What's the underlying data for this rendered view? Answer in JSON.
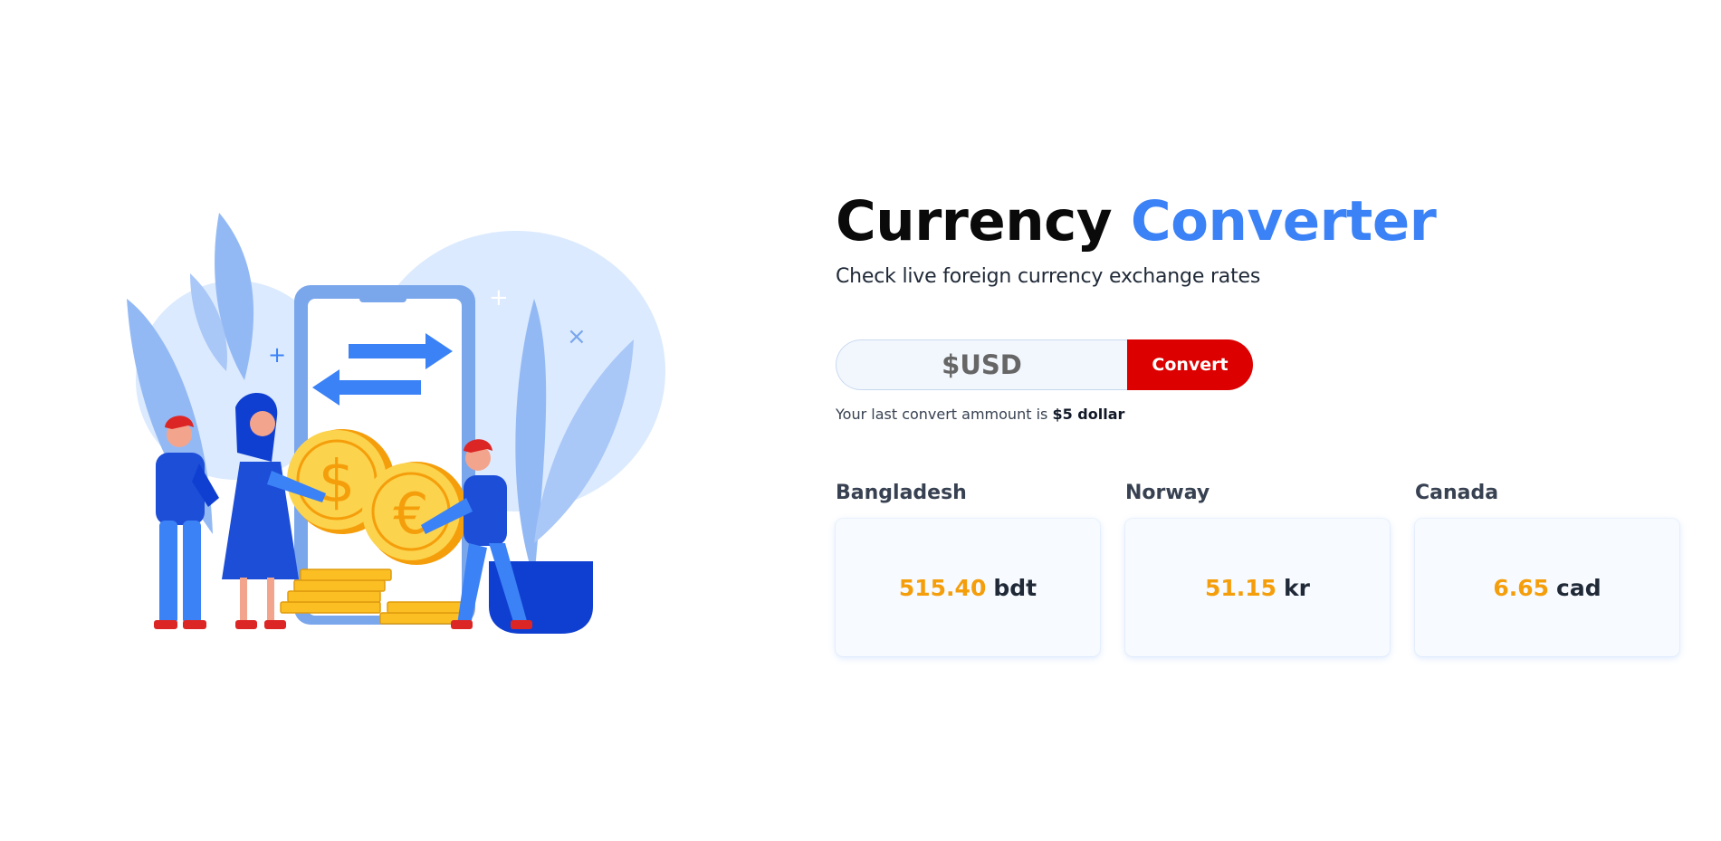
{
  "illustration": {
    "name": "currency exchange illustration",
    "colors": {
      "light_blue": "#dbeafe",
      "mid_blue": "#93b9f5",
      "blue": "#3b82f6",
      "dark_blue": "#0f3fd1",
      "gold": "#fbbf24",
      "red": "#dc2626"
    }
  },
  "header": {
    "title_main": "Currency",
    "title_accent": "Converter",
    "subtitle": "Check live foreign currency exchange rates"
  },
  "converter": {
    "input_placeholder": "$USD",
    "input_value": "",
    "button_label": "Convert",
    "accent_color": "#dc0000",
    "last_note_prefix": "Your last convert ammount is",
    "last_amount": "$5 dollar"
  },
  "rates": [
    {
      "country": "Bangladesh",
      "value": "515.40",
      "unit": "bdt"
    },
    {
      "country": "Norway",
      "value": "51.15",
      "unit": "kr"
    },
    {
      "country": "Canada",
      "value": "6.65",
      "unit": "cad"
    }
  ]
}
